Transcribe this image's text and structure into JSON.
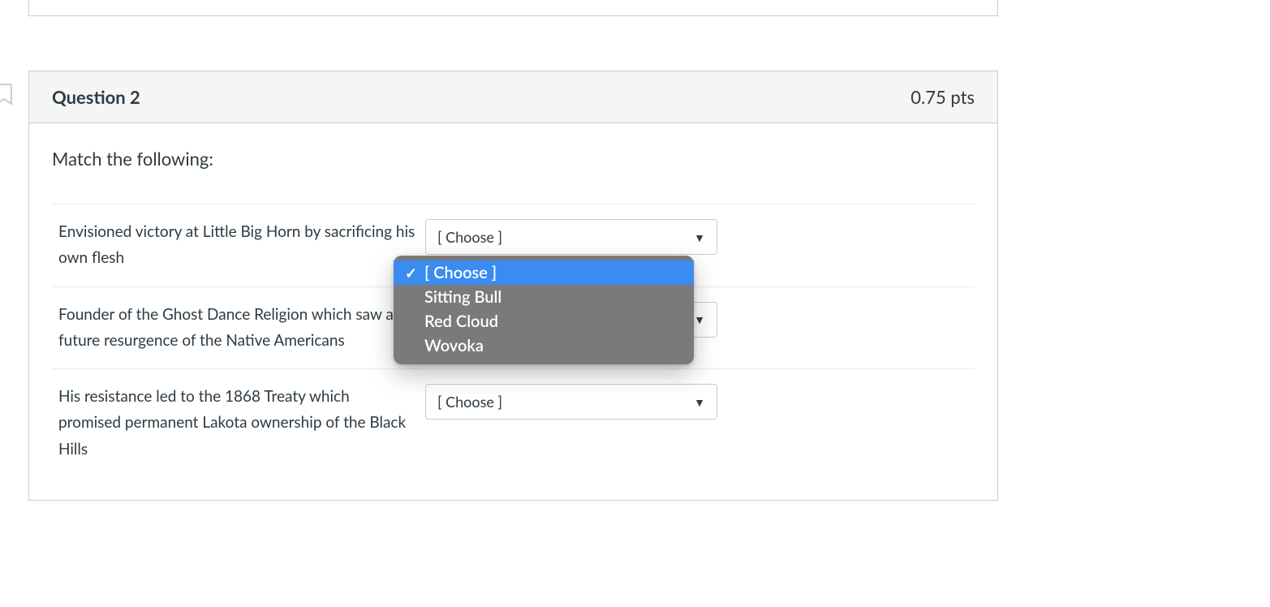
{
  "question": {
    "title": "Question 2",
    "points": "0.75 pts",
    "instructions": "Match the following:",
    "rows": [
      {
        "prompt": "Envisioned victory at Little Big Horn by sacrificing his own flesh",
        "selected": "[ Choose ]"
      },
      {
        "prompt": "Founder of the Ghost Dance Religion which saw a future resurgence of the Native Americans",
        "selected": "[ Choose ]"
      },
      {
        "prompt": "His resistance led to the 1868 Treaty which promised permanent Lakota ownership of the Black Hills",
        "selected": "[ Choose ]"
      }
    ]
  },
  "dropdown": {
    "options": [
      {
        "label": "[ Choose ]",
        "selected": true
      },
      {
        "label": "Sitting Bull",
        "selected": false
      },
      {
        "label": "Red Cloud",
        "selected": false
      },
      {
        "label": "Wovoka",
        "selected": false
      }
    ]
  }
}
